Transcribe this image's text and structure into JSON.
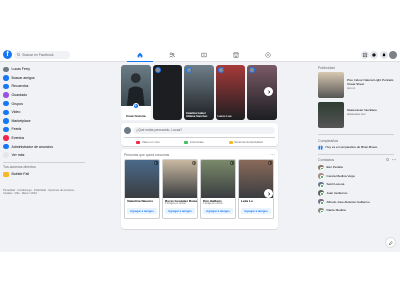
{
  "topbar": {
    "logo": "f",
    "search_placeholder": "Buscar en Facebook",
    "nav_tabs": [
      {
        "name": "home-icon",
        "active": true
      },
      {
        "name": "friends-icon",
        "active": false
      },
      {
        "name": "watch-icon",
        "active": false
      },
      {
        "name": "marketplace-icon",
        "active": false
      },
      {
        "name": "gaming-icon",
        "active": false
      }
    ],
    "right_buttons": [
      "menu-grid-icon",
      "messenger-icon",
      "notifications-icon"
    ]
  },
  "sidebar": {
    "user_name": "Lucas Ferry",
    "items": [
      {
        "label": "Buscar amigos",
        "icon": "friends-icon",
        "color": "#1877f2"
      },
      {
        "label": "Recuerdos",
        "icon": "memories-icon",
        "color": "#1877f2"
      },
      {
        "label": "Guardado",
        "icon": "saved-icon",
        "color": "#9b51e0"
      },
      {
        "label": "Grupos",
        "icon": "groups-icon",
        "color": "#1877f2"
      },
      {
        "label": "Video",
        "icon": "video-icon",
        "color": "#1877f2"
      },
      {
        "label": "Marketplace",
        "icon": "marketplace-icon",
        "color": "#1877f2"
      },
      {
        "label": "Feeds",
        "icon": "feeds-icon",
        "color": "#1877f2"
      },
      {
        "label": "Eventos",
        "icon": "events-icon",
        "color": "#f02849"
      },
      {
        "label": "Administrador de anuncios",
        "icon": "ads-manager-icon",
        "color": "#1877f2"
      },
      {
        "label": "Ver más",
        "icon": "chevron-down-icon",
        "color": "#e4e6eb"
      }
    ],
    "shortcuts_title": "Tus accesos directos",
    "shortcuts": [
      {
        "label": "Bubble Fall",
        "icon": "game-icon",
        "color": "#f7b928"
      }
    ],
    "footer": "Privacidad · Condiciones · Publicidad · Opciones de anuncios · Cookies · Más · Meta © 2024"
  },
  "stories": {
    "create_label": "Crear historia",
    "items": [
      {
        "caption": "",
        "color": "#1c1e21"
      },
      {
        "caption": "Catalina Isabel Aldana Sanchez",
        "color": "#6f7f8a"
      },
      {
        "caption": "Lacos Luu",
        "color": "#a83a3a"
      },
      {
        "caption": "",
        "color": "#7a5a66"
      }
    ]
  },
  "composer": {
    "placeholder": "¿Qué estás pensando, Lucas?",
    "actions": [
      {
        "label": "Video en vivo",
        "color": "#f02849"
      },
      {
        "label": "Foto/video",
        "color": "#45bd62"
      },
      {
        "label": "Sentimiento/actividad",
        "color": "#f7b928"
      }
    ]
  },
  "pymk": {
    "title": "Personas que quizá conozcas",
    "more": "···",
    "add_label": "Agregar a amigos",
    "people": [
      {
        "name": "Valentina Navarro",
        "mutual": "",
        "color": "#4a6a8a"
      },
      {
        "name": "Rocio González Rojas",
        "mutual": "2 amigos en común",
        "color": "#c9b8a0"
      },
      {
        "name": "Kim Haillaris",
        "mutual": "1 amigo en común",
        "color": "#7a8a6a"
      },
      {
        "name": "Leila Lu",
        "mutual": "",
        "color": "#8a6a5a"
      }
    ]
  },
  "right": {
    "sponsored_title": "Publicidad",
    "ads": [
      {
        "title": "Pixo Indoor Natural Light Portraits Cheat Sheet",
        "url": "pixo.co",
        "color": "#d8c8b0"
      },
      {
        "title": "Skatecaster Necklace",
        "url": "skatecaster.com",
        "color": "#2e3d33"
      }
    ],
    "birthdays_title": "Cumpleaños",
    "birthday_text": "Hoy es el cumpleaños de Brian Bravo.",
    "contacts_title": "Contactos",
    "contacts": [
      "Eler Peralta",
      "Cerela Medina Vega",
      "Seiril Lucena",
      "Juan Guillermo",
      "Alfredo Jose Alcantar Guillermo",
      "Dante Medina"
    ],
    "contact_colors": [
      "#8a7a6a",
      "#a89080",
      "#6a7a8a",
      "#5a6a5a",
      "#7a6a8a",
      "#8a8a7a"
    ]
  }
}
